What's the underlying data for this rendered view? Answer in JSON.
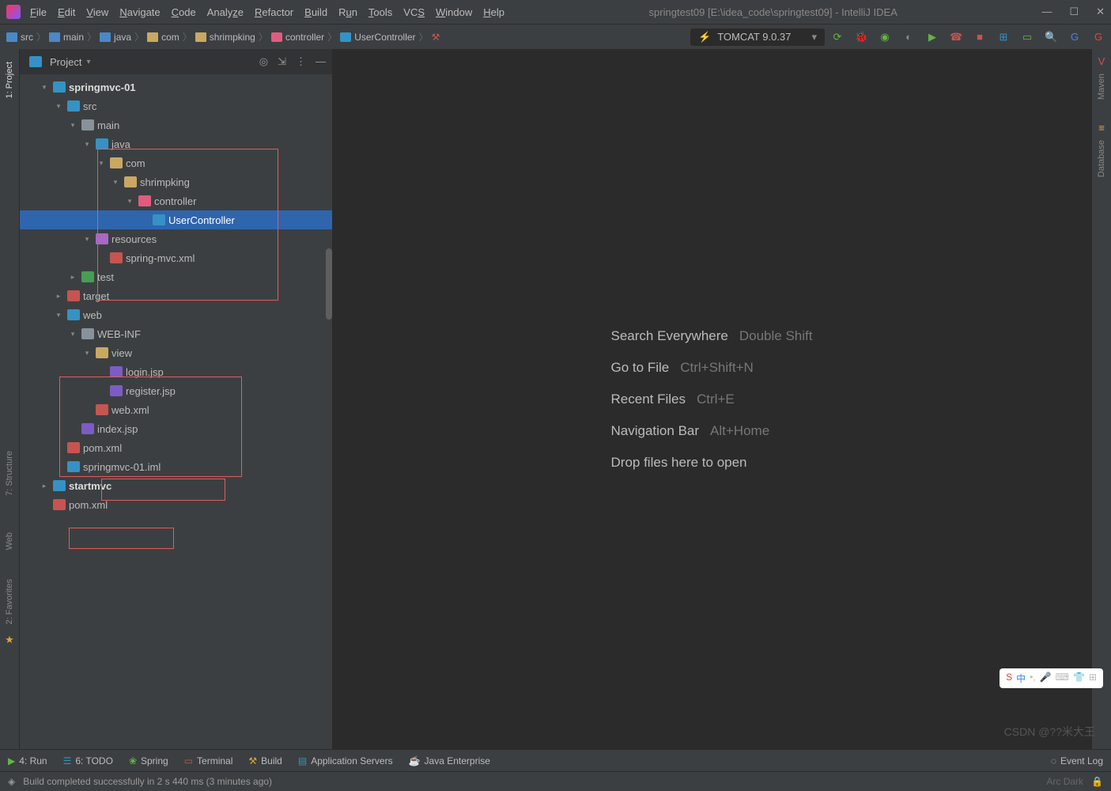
{
  "title": "springtest09 [E:\\idea_code\\springtest09] - IntelliJ IDEA",
  "menu": [
    "File",
    "Edit",
    "View",
    "Navigate",
    "Code",
    "Analyze",
    "Refactor",
    "Build",
    "Run",
    "Tools",
    "VCS",
    "Window",
    "Help"
  ],
  "breadcrumb": [
    "src",
    "main",
    "java",
    "com",
    "shrimpking",
    "controller",
    "UserController"
  ],
  "runConfig": "TOMCAT 9.0.37",
  "panel": {
    "title": "Project"
  },
  "tree": {
    "n0": "springmvc-01",
    "n1": "src",
    "n2": "main",
    "n3": "java",
    "n4": "com",
    "n5": "shrimpking",
    "n6": "controller",
    "n7": "UserController",
    "n8": "resources",
    "n9": "spring-mvc.xml",
    "n10": "test",
    "n11": "target",
    "n12": "web",
    "n13": "WEB-INF",
    "n14": "view",
    "n15": "login.jsp",
    "n16": "register.jsp",
    "n17": "web.xml",
    "n18": "index.jsp",
    "n19": "pom.xml",
    "n20": "springmvc-01.iml",
    "n21": "startmvc",
    "n22": "pom.xml"
  },
  "welcome": [
    {
      "label": "Search Everywhere",
      "key": "Double Shift"
    },
    {
      "label": "Go to File",
      "key": "Ctrl+Shift+N"
    },
    {
      "label": "Recent Files",
      "key": "Ctrl+E"
    },
    {
      "label": "Navigation Bar",
      "key": "Alt+Home"
    },
    {
      "label": "Drop files here to open",
      "key": ""
    }
  ],
  "leftGutter": [
    "1: Project",
    "7: Structure",
    "Web",
    "2: Favorites"
  ],
  "rightGutter": [
    "Maven",
    "Database"
  ],
  "bottomBar": {
    "run": "4: Run",
    "todo": "6: TODO",
    "spring": "Spring",
    "terminal": "Terminal",
    "build": "Build",
    "appservers": "Application Servers",
    "javaee": "Java Enterprise",
    "eventlog": "Event Log"
  },
  "status": "Build completed successfully in 2 s 440 ms (3 minutes ago)",
  "watermark": "CSDN @??米大王",
  "theme": "Arc Dark"
}
